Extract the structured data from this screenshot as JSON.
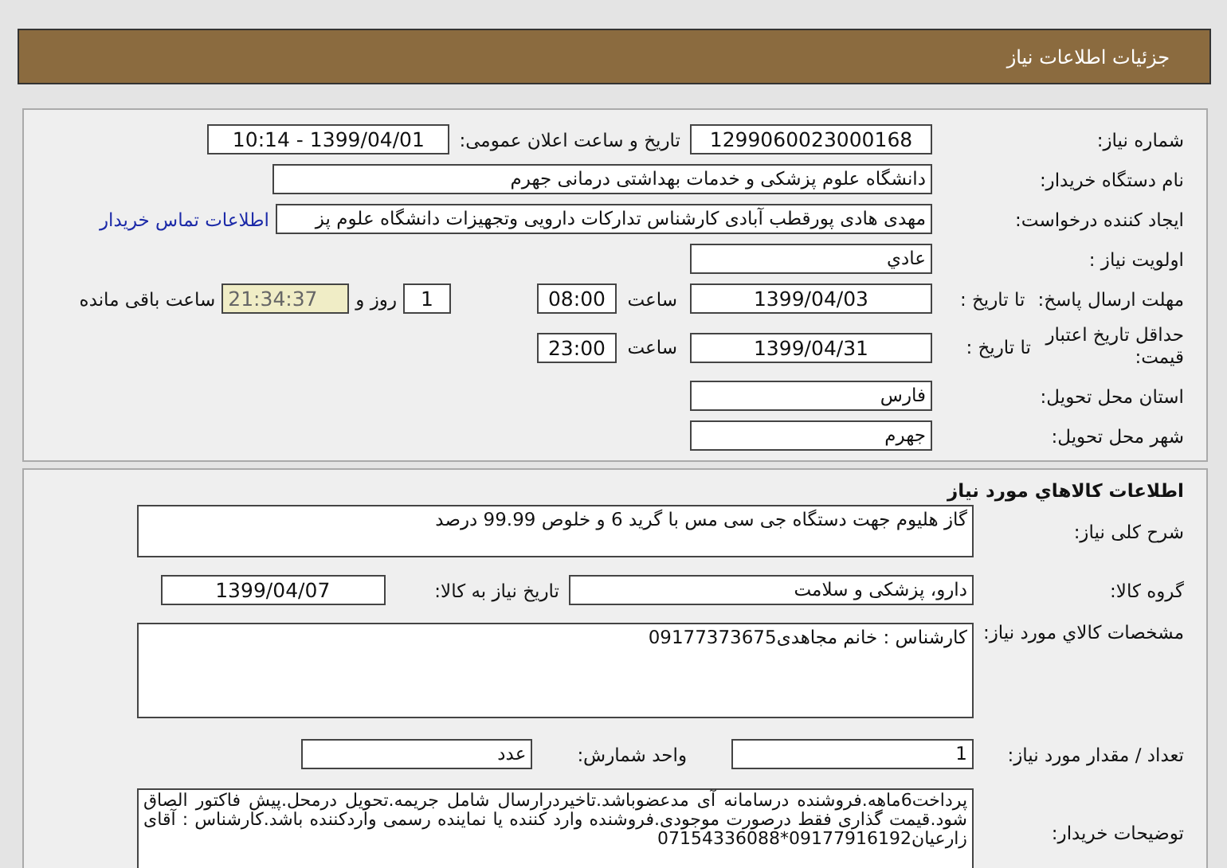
{
  "header": {
    "title": "جزئیات اطلاعات نیاز"
  },
  "need_info": {
    "need_number_label": "شماره نیاز:",
    "need_number": "1299060023000168",
    "announce_label": "تاریخ و ساعت اعلان عمومی:",
    "announce_datetime": "1399/04/01 - 10:14",
    "buyer_label": "نام دستگاه خریدار:",
    "buyer": "دانشگاه علوم پزشکی و خدمات بهداشتی درمانی جهرم",
    "requester_label": "ایجاد کننده درخواست:",
    "requester": "مهدی هادی پورقطب آبادی کارشناس تدارکات دارویی وتجهیزات دانشگاه علوم پز",
    "contact_link": "اطلاعات تماس خریدار",
    "priority_label": "اولویت نیاز :",
    "priority": "عادي",
    "deadline": {
      "label": "مهلت ارسال پاسخ:",
      "to_date_label": "تا تاریخ :",
      "date": "1399/04/03",
      "time_label": "ساعت",
      "time": "08:00",
      "days": "1",
      "days_label": "روز و",
      "remaining": "21:34:37",
      "remaining_label": "ساعت باقی مانده"
    },
    "validity": {
      "label": "حداقل تاریخ اعتبار قیمت:",
      "to_date_label": "تا تاریخ :",
      "date": "1399/04/31",
      "time_label": "ساعت",
      "time": "23:00"
    },
    "province_label": "استان محل تحویل:",
    "province": "فارس",
    "city_label": "شهر محل تحویل:",
    "city": "جهرم"
  },
  "goods": {
    "title": "اطلاعات کالاهاي مورد نیاز",
    "description_label": "شرح کلی نیاز:",
    "description": "گاز هلیوم جهت دستگاه جی سی مس  با گرید 6 و خلوص 99.99 درصد",
    "group_label": "گروه کالا:",
    "group": "دارو، پزشکی و سلامت",
    "need_date_label": "تاریخ نیاز به کالا:",
    "need_date": "1399/04/07",
    "specs_label": "مشخصات کالاي مورد نیاز:",
    "specs": "کارشناس : خانم  مجاهدی09177373675",
    "quantity_label": "تعداد / مقدار مورد نیاز:",
    "quantity": "1",
    "unit_label": "واحد شمارش:",
    "unit": "عدد",
    "notes_label": "توضیحات خریدار:",
    "notes": " پرداخت6ماهه.فروشنده درسامانه آی مدعضوباشد.تاخیردرارسال شامل جریمه.تحویل درمحل.پیش فاکتور الصاق شود.قیمت گذاری فقط درصورت موجودی.فروشنده وارد کننده یا نماینده رسمی واردکننده باشد.کارشناس : آقای زارعیان09177916192*07154336088"
  }
}
